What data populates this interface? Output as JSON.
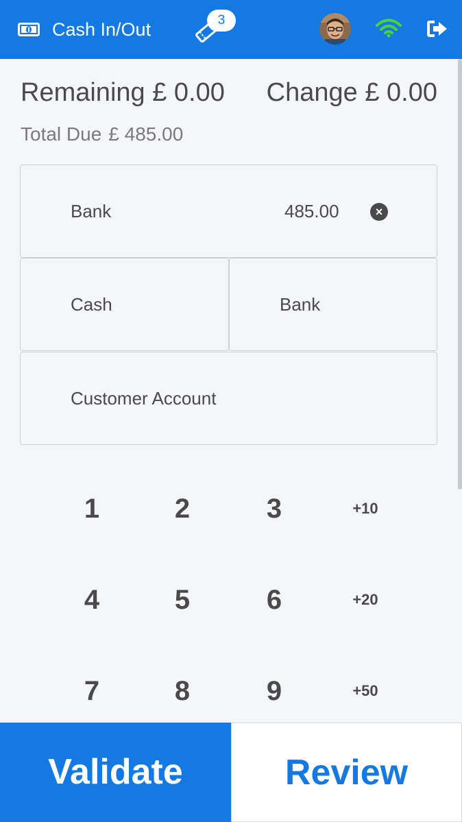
{
  "header": {
    "cash_in_out_label": "Cash In/Out",
    "orders_count": "3",
    "accent_color": "#1479e2",
    "wifi_color": "#4cd13b",
    "icons": [
      "money-icon",
      "ticket-icon",
      "avatar",
      "wifi-icon",
      "logout-icon"
    ]
  },
  "summary": {
    "remaining_label": "Remaining",
    "remaining_value": "£ 0.00",
    "change_label": "Change",
    "change_value": "£ 0.00",
    "total_due_label": "Total Due",
    "total_due_value": "£ 485.00"
  },
  "paymentlines": [
    {
      "name": "Bank",
      "amount": "485.00"
    }
  ],
  "payment_methods": [
    "Cash",
    "Bank",
    "Customer Account"
  ],
  "numpad": {
    "keys": [
      "1",
      "2",
      "3",
      "+10",
      "4",
      "5",
      "6",
      "+20",
      "7",
      "8",
      "9",
      "+50"
    ]
  },
  "footer": {
    "validate_label": "Validate",
    "review_label": "Review"
  }
}
